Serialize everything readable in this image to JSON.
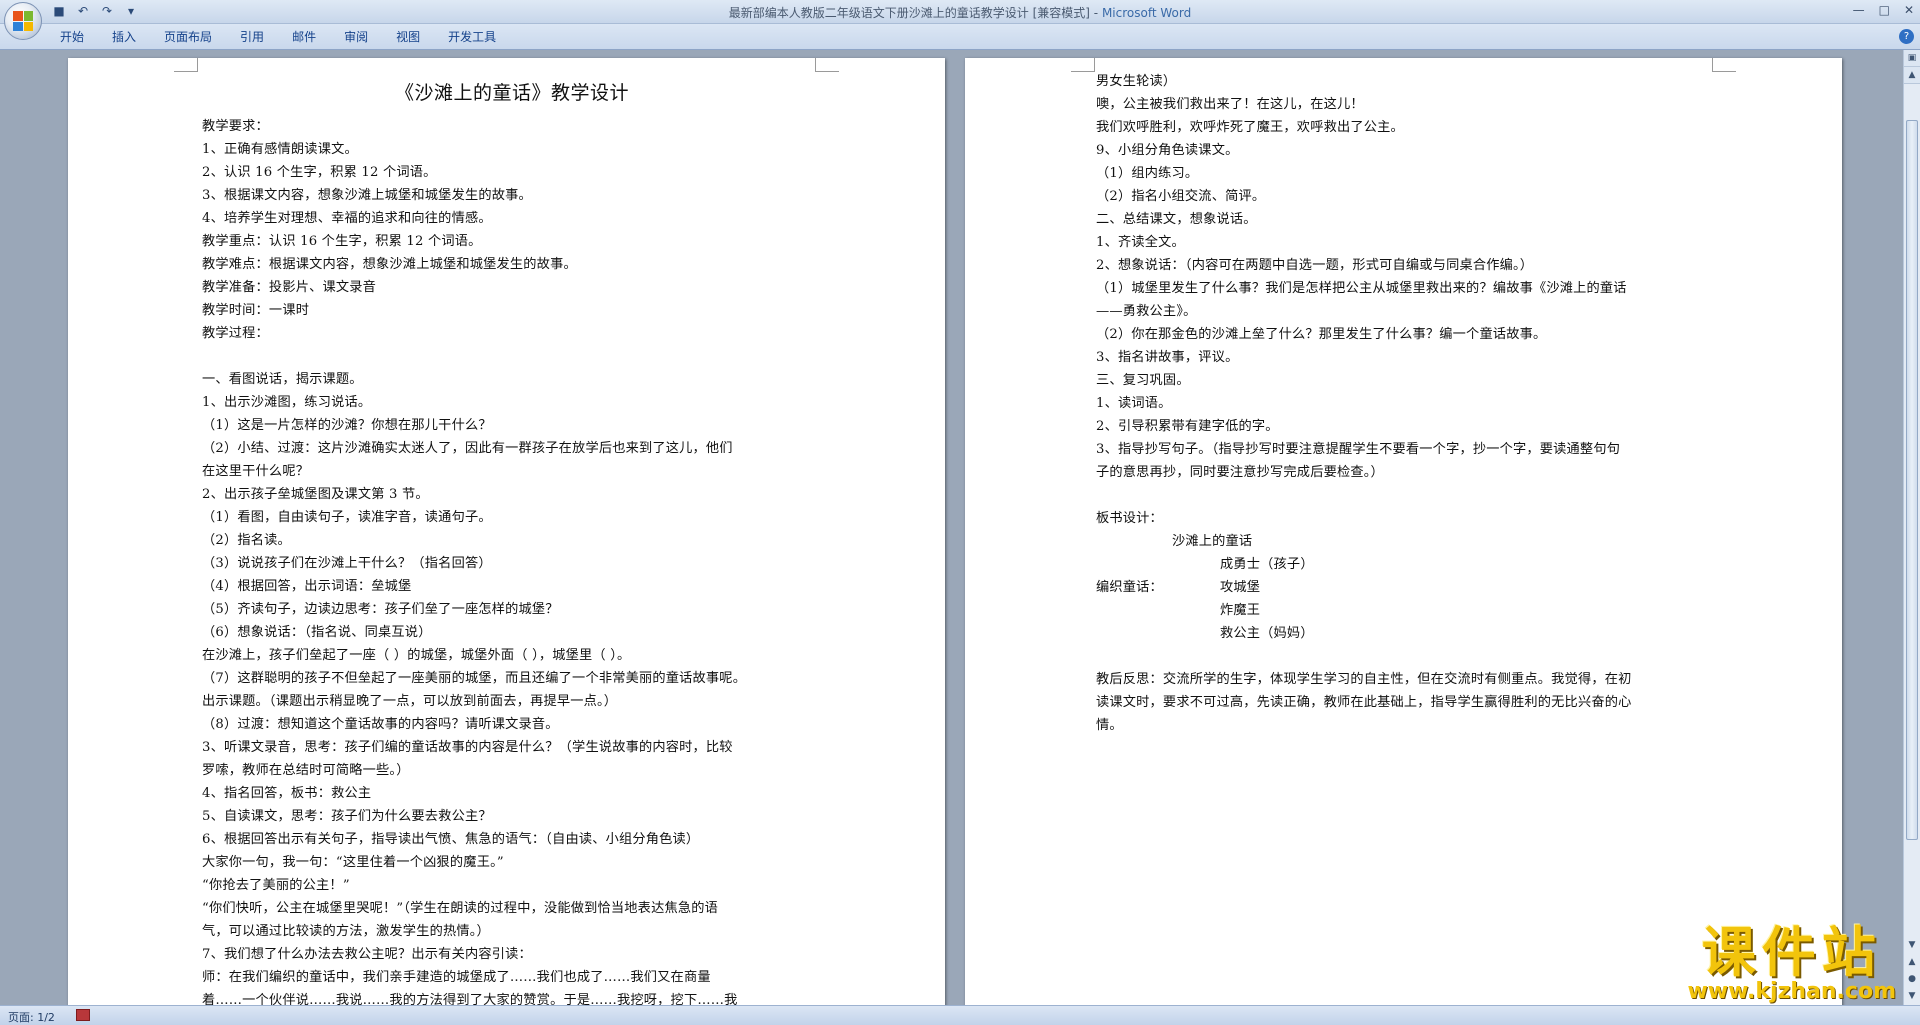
{
  "window": {
    "title": "最新部编本人教版二年级语文下册沙滩上的童话教学设计 [兼容模式]",
    "app_name": "Microsoft Word",
    "separator": " - "
  },
  "quick_access": [
    "save-icon",
    "undo-icon",
    "redo-icon",
    "customize-icon"
  ],
  "ribbon": {
    "tabs": [
      "开始",
      "插入",
      "页面布局",
      "引用",
      "邮件",
      "审阅",
      "视图",
      "开发工具"
    ]
  },
  "left_page": {
    "title": "《沙滩上的童话》教学设计",
    "lines": [
      "教学要求：",
      "1、正确有感情朗读课文。",
      "2、认识 16 个生字，积累 12 个词语。",
      "3、根据课文内容，想象沙滩上城堡和城堡发生的故事。",
      "4、培养学生对理想、幸福的追求和向往的情感。",
      "教学重点：认识 16 个生字，积累 12 个词语。",
      "教学难点：根据课文内容，想象沙滩上城堡和城堡发生的故事。",
      "教学准备：投影片、课文录音",
      "教学时间：一课时",
      "教学过程：",
      "",
      "一、看图说话，揭示课题。",
      "1、出示沙滩图，练习说话。",
      "（1）这是一片怎样的沙滩？你想在那儿干什么？",
      "（2）小结、过渡：这片沙滩确实太迷人了，因此有一群孩子在放学后也来到了这儿，他们",
      "在这里干什么呢？",
      "2、出示孩子垒城堡图及课文第 3 节。",
      "（1）看图，自由读句子，读准字音，读通句子。",
      "（2）指名读。",
      "（3）说说孩子们在沙滩上干什么？（指名回答）",
      "（4）根据回答，出示词语：垒城堡",
      "（5）齐读句子，边读边思考：孩子们垒了一座怎样的城堡？",
      "（6）想象说话：（指名说、同桌互说）",
      "在沙滩上，孩子们垒起了一座（ ）的城堡，城堡外面（ ），城堡里（ ）。",
      "（7）这群聪明的孩子不但垒起了一座美丽的城堡，而且还编了一个非常美丽的童话故事呢。",
      "出示课题。（课题出示稍显晚了一点，可以放到前面去，再提早一点。）",
      "（8）过渡：想知道这个童话故事的内容吗？请听课文录音。",
      "3、听课文录音，思考：孩子们编的童话故事的内容是什么？（学生说故事的内容时，比较",
      "罗嗦，教师在总结时可简略一些。）",
      "4、指名回答，板书：救公主",
      "5、自读课文，思考：孩子们为什么要去救公主？",
      "6、根据回答出示有关句子，指导读出气愤、焦急的语气：（自由读、小组分角色读）",
      "大家你一句，我一句：“这里住着一个凶狠的魔王。”",
      "“你抢去了美丽的公主！”",
      "“你们快听，公主在城堡里哭呢！”（学生在朗读的过程中，没能做到恰当地表达焦急的语",
      "气，可以通过比较读的方法，激发学生的热情。）",
      "7、我们想了什么办法去救公主呢？出示有关内容引读：",
      "师：在我们编织的童话中，我们亲手建造的城堡成了……我们也成了……我们又在商量",
      "着……一个伙伴说……我说……我的方法得到了大家的赞赏。于是……我挖呀，挖下……我"
    ]
  },
  "right_page": {
    "lines": [
      "男女生轮读）",
      "噢，公主被我们救出来了！在这儿，在这儿！",
      "我们欢呼胜利，欢呼炸死了魔王，欢呼救出了公主。",
      "9、小组分角色读课文。",
      "（1）组内练习。",
      "（2）指名小组交流、简评。",
      "二、总结课文，想象说话。",
      "1、齐读全文。",
      "2、想象说话：（内容可在两题中自选一题，形式可自编或与同桌合作编。）",
      "（1）城堡里发生了什么事？我们是怎样把公主从城堡里救出来的？编故事《沙滩上的童话",
      "——勇救公主》。",
      "（2）你在那金色的沙滩上垒了什么？那里发生了什么事？编一个童话故事。",
      "3、指名讲故事，评议。",
      "三、复习巩固。",
      "1、读词语。",
      "2、引导积累带有建字低的字。",
      "3、指导抄写句子。（指导抄写时要注意提醒学生不要看一个字，抄一个字，要读通整句句",
      "子的意思再抄，同时要注意抄写完成后要检查。）",
      ""
    ],
    "board": {
      "heading": "板书设计：",
      "center": "沙滩上的童话",
      "item1": "成勇士（孩子）",
      "label": "编织童话：",
      "item2": "攻城堡",
      "item3": "炸魔王",
      "item4": "救公主（妈妈）"
    },
    "reflection_lines": [
      "教后反思：交流所学的生字，体现学生学习的自主性，但在交流时有侧重点。我觉得，在初",
      "读课文时，要求不可过高，先读正确，教师在此基础上，指导学生赢得胜利的无比兴奋的心",
      "情。"
    ]
  },
  "status": {
    "page": "页面: 1/2"
  },
  "watermark": {
    "brand": "课件站",
    "url": "www.kjzhan.com"
  },
  "colors": {
    "workspace": "#9aa7b8",
    "ribbon_text": "#15428b",
    "watermark": "#f2c40c"
  }
}
